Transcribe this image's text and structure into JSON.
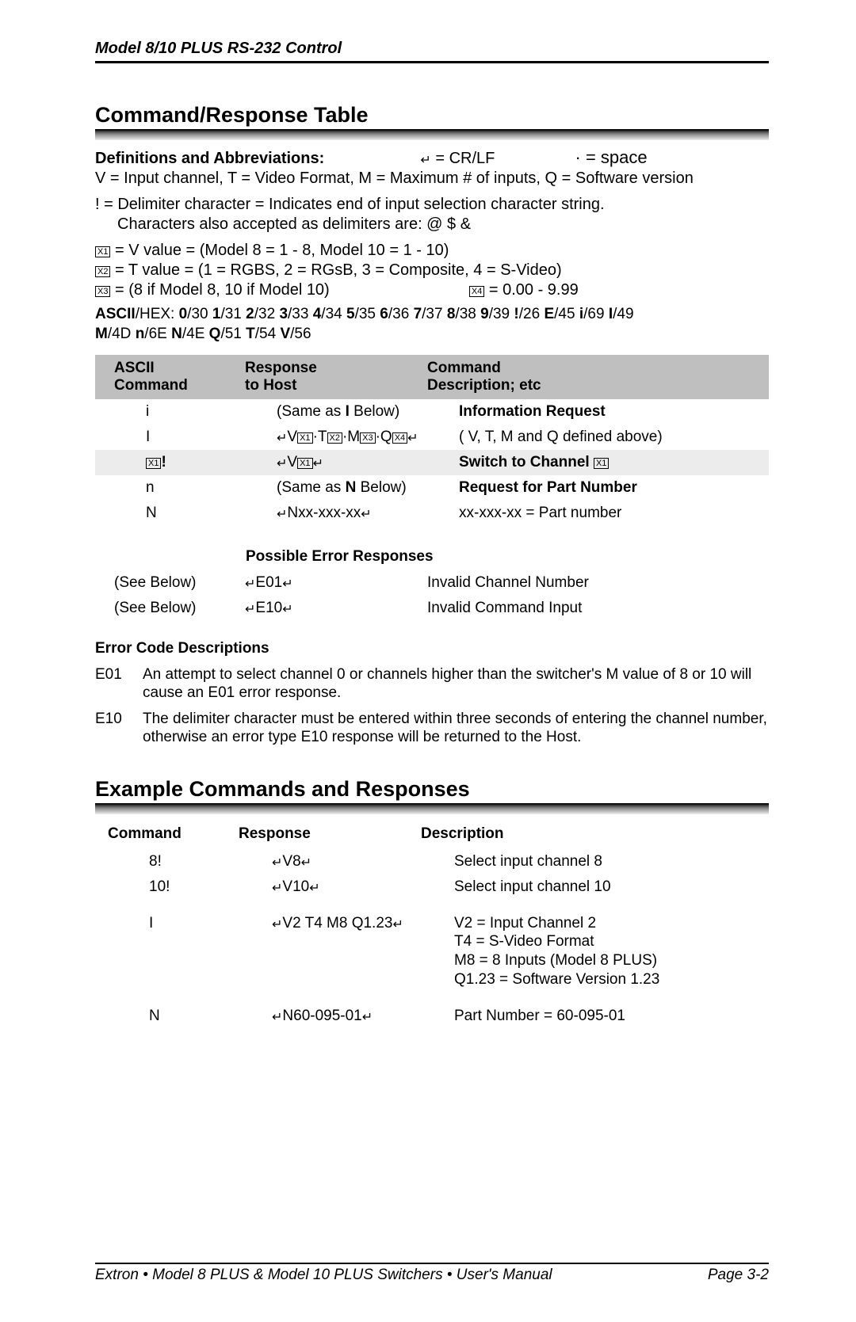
{
  "header": "Model 8/10 PLUS RS-232 Control",
  "section1_title": "Command/Response Table",
  "definitions": {
    "label": "Definitions and Abbreviations:",
    "crlf_legend": " = CR/LF",
    "space_legend": "· = space",
    "line1": "V = Input channel, T = Video Format, M = Maximum # of inputs, Q = Software version",
    "line2": "! = Delimiter character = Indicates end of input selection character string.",
    "line2b": "Characters also accepted as delimiters are: @ $ &",
    "x1": " = V value = (Model 8 = 1 - 8, Model 10 = 1 - 10)",
    "x2": " = T value = (1 = RGBS, 2 = RGsB, 3 = Composite, 4 = S-Video)",
    "x3": " = (8 if Model 8, 10 if Model 10)",
    "x4": " = 0.00 - 9.99"
  },
  "ascii_hex": {
    "prefix": "ASCII",
    "prefix2": "/HEX: ",
    "pairs": [
      {
        "b": "0",
        "v": "/30 "
      },
      {
        "b": "1",
        "v": "/31 "
      },
      {
        "b": "2",
        "v": "/32 "
      },
      {
        "b": "3",
        "v": "/33 "
      },
      {
        "b": "4",
        "v": "/34 "
      },
      {
        "b": "5",
        "v": "/35 "
      },
      {
        "b": "6",
        "v": "/36 "
      },
      {
        "b": "7",
        "v": "/37 "
      },
      {
        "b": "8",
        "v": "/38 "
      },
      {
        "b": "9",
        "v": "/39 "
      },
      {
        "b": "!",
        "v": "/26 "
      },
      {
        "b": "E",
        "v": "/45 "
      },
      {
        "b": "i",
        "v": "/69 "
      },
      {
        "b": "I",
        "v": "/49"
      }
    ],
    "pairs2": [
      {
        "b": "M",
        "v": "/4D "
      },
      {
        "b": "n",
        "v": "/6E "
      },
      {
        "b": "N",
        "v": "/4E "
      },
      {
        "b": "Q",
        "v": "/51 "
      },
      {
        "b": "T",
        "v": "/54 "
      },
      {
        "b": "V",
        "v": "/56"
      }
    ]
  },
  "table_headers": {
    "c1a": "ASCII",
    "c1b": "Command",
    "c2a": "Response",
    "c2b": "to Host",
    "c3a": "Command",
    "c3b": "Description; etc"
  },
  "rows": [
    {
      "cmd": "i",
      "resp_plain": "(Same as ",
      "resp_bold": "I",
      "resp_plain2": " Below)",
      "desc_bold": "Information Request",
      "desc_plain": ""
    },
    {
      "cmd": "I",
      "resp_crlf": true,
      "resp_seq": [
        "V",
        "X1",
        "·T",
        "X2",
        "·M",
        "X3",
        "·Q",
        "X4"
      ],
      "resp_trail_crlf": true,
      "desc_plain": "( V, T, M and Q defined above)"
    },
    {
      "shade": true,
      "cmd_box": "X1",
      "cmd_suffix": "!",
      "resp_crlf": true,
      "resp_seq": [
        "V",
        "X1"
      ],
      "resp_trail_crlf": true,
      "desc_bold": "Switch to Channel ",
      "desc_box": "X1"
    },
    {
      "cmd": "n",
      "resp_plain": "(Same as ",
      "resp_bold": "N",
      "resp_plain2": " Below)",
      "desc_bold": "Request for Part Number"
    },
    {
      "cmd": "N",
      "resp_crlf": true,
      "resp_text": "Nxx-xxx-xx",
      "resp_trail_crlf": true,
      "desc_plain": "xx-xxx-xx = Part number"
    }
  ],
  "error_subhead": "Possible Error Responses",
  "error_rows": [
    {
      "cmd": "(See Below)",
      "code": "E01",
      "desc": "Invalid Channel Number"
    },
    {
      "cmd": "(See Below)",
      "code": "E10",
      "desc": "Invalid Command Input"
    }
  ],
  "error_code_head": "Error Code Descriptions",
  "error_codes": [
    {
      "code": "E01",
      "text": "An attempt to select channel 0 or channels higher than the switcher's M value of 8 or 10 will cause an E01 error response."
    },
    {
      "code": "E10",
      "text": "The delimiter character must be entered within three seconds of entering the channel number, otherwise an error type E10 response will be returned to the Host."
    }
  ],
  "section2_title": "Example Commands and Responses",
  "ex_headers": {
    "c1": "Command",
    "c2": "Response",
    "c3": "Description"
  },
  "ex_rows": [
    {
      "cmd": "8!",
      "resp": "V8",
      "desc": "Select input channel 8"
    },
    {
      "cmd": "10!",
      "resp": "V10",
      "desc": "Select input channel 10"
    },
    {
      "cmd": "I",
      "resp": "V2 T4 M8 Q1.23",
      "desc_lines": [
        "V2 = Input Channel 2",
        "T4 = S-Video Format",
        "M8 = 8 Inputs (Model 8 PLUS)",
        "Q1.23 = Software Version 1.23"
      ],
      "spaced": true
    },
    {
      "cmd": "N",
      "resp": "N60-095-01",
      "desc": "Part Number = 60-095-01",
      "spaced": true
    }
  ],
  "footer_left": "Extron • Model 8 PLUS & Model 10 PLUS Switchers • User's Manual",
  "footer_right": "Page 3-2"
}
